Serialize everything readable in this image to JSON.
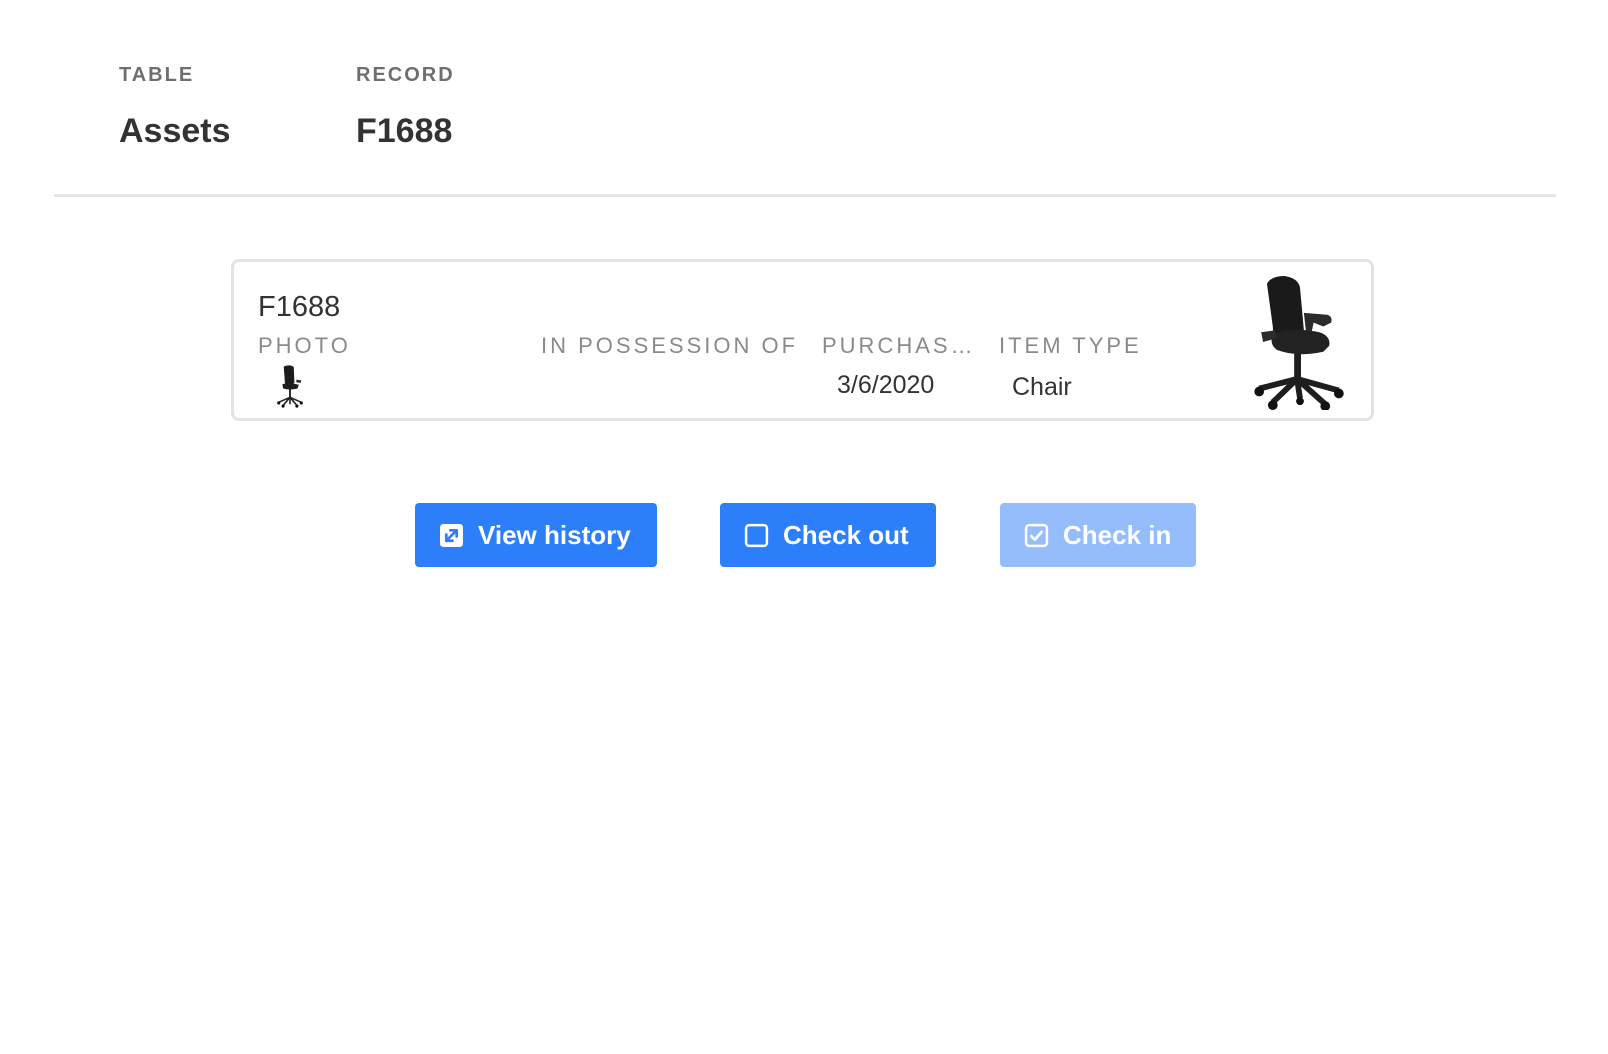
{
  "header": {
    "table_label": "TABLE",
    "table_value": "Assets",
    "record_label": "RECORD",
    "record_value": "F1688"
  },
  "record_card": {
    "title": "F1688",
    "fields": {
      "photo": {
        "label": "PHOTO",
        "icon": "chair-photo-thumbnail"
      },
      "in_possession_of": {
        "label": "IN POSSESSION OF",
        "value": ""
      },
      "purchase_date": {
        "label": "PURCHASE…",
        "value": "3/6/2020"
      },
      "item_type": {
        "label": "ITEM TYPE",
        "value": "Chair"
      }
    },
    "cover_photo": {
      "icon": "office-chair-photo"
    }
  },
  "actions": {
    "view_history": {
      "label": "View history",
      "icon": "expand-icon",
      "enabled": true
    },
    "check_out": {
      "label": "Check out",
      "icon": "checkbox-empty-icon",
      "enabled": true
    },
    "check_in": {
      "label": "Check in",
      "icon": "checkbox-checked-icon",
      "enabled": false
    }
  },
  "colors": {
    "primary_button": "#2d7ff9",
    "disabled_button": "#95bdfb",
    "label_gray": "#8a8a8a",
    "text_dark": "#333333"
  }
}
